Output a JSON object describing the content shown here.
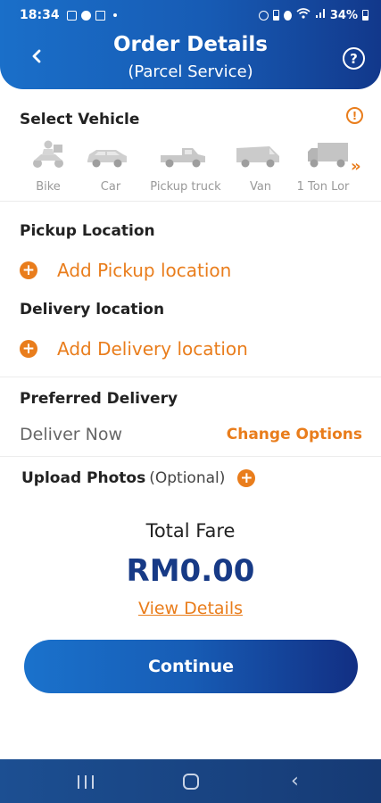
{
  "status_bar": {
    "time": "18:34",
    "battery": "34%"
  },
  "header": {
    "title": "Order Details",
    "subtitle": "(Parcel Service)",
    "back_icon": "chevron-left-icon",
    "help_icon": "question-circle-icon"
  },
  "vehicle_section": {
    "title": "Select Vehicle",
    "info_icon": "info-icon",
    "vehicles": [
      {
        "label": "Bike",
        "icon": "scooter-icon"
      },
      {
        "label": "Car",
        "icon": "car-icon"
      },
      {
        "label": "Pickup truck",
        "icon": "pickup-truck-icon"
      },
      {
        "label": "Van",
        "icon": "van-icon"
      },
      {
        "label": "1 Ton Lor",
        "icon": "lorry-icon"
      }
    ],
    "more_icon": "double-chevron-right-icon"
  },
  "pickup": {
    "title": "Pickup Location",
    "add_label": "Add Pickup location"
  },
  "delivery": {
    "title": "Delivery location",
    "add_label": "Add Delivery location"
  },
  "preferred_delivery": {
    "title": "Preferred Delivery",
    "value": "Deliver Now",
    "change_label": "Change Options"
  },
  "upload": {
    "title": "Upload Photos",
    "optional": "(Optional)"
  },
  "fare": {
    "label": "Total Fare",
    "amount": "RM0.00",
    "details_link": "View Details"
  },
  "continue_label": "Continue",
  "colors": {
    "brand_blue": "#175bb4",
    "brand_dark_blue": "#173a86",
    "accent_orange": "#e97d1c"
  }
}
